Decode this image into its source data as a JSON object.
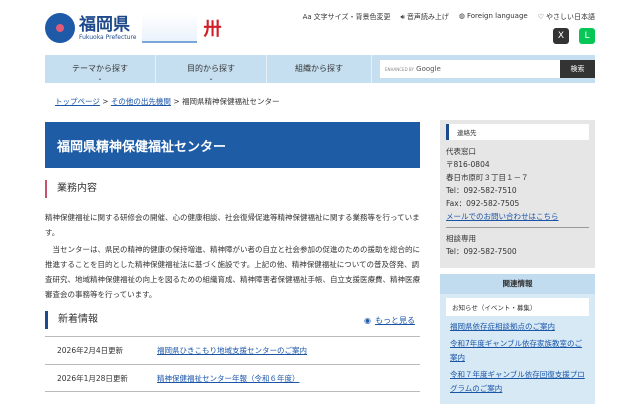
{
  "header": {
    "logo_title": "福岡県",
    "logo_sub": "Fukuoka Prefecture",
    "mascot": "卅",
    "utility": [
      {
        "icon": "text-size-icon",
        "label": "文字サイズ・背景色変更"
      },
      {
        "icon": "speaker-icon",
        "label": "音声読み上げ"
      },
      {
        "icon": "globe-icon",
        "label": "Foreign language"
      },
      {
        "icon": "heart-icon",
        "label": "やさしい日本語"
      }
    ],
    "sns": [
      {
        "name": "x",
        "label": "X",
        "color": "#333333"
      },
      {
        "name": "line",
        "label": "L",
        "color": "#06c755"
      }
    ]
  },
  "nav": {
    "items": [
      "テーマから探す",
      "目的から探す",
      "組織から探す"
    ],
    "search_placeholder_small": "ENHANCED BY",
    "search_placeholder": "Google",
    "search_button": "検索"
  },
  "breadcrumb": {
    "items": [
      "トップページ",
      "その他の出先機関"
    ],
    "current": "福岡県精神保健福祉センター",
    "sep": ">"
  },
  "main": {
    "title": "福岡県精神保健福祉センター",
    "section_title": "業務内容",
    "para1": "精神保健福祉に関する研修会の開催、心の健康相談、社会復帰促進等精神保健福祉に関する業務等を行っています。",
    "para2": "　当センターは、県民の精神的健康の保持増進、精神障がい者の自立と社会参加の促進のための援助を総合的に推進することを目的とした精神保健福祉法に基づく施設です。上記の他、精神保健福祉についての普及啓発、調査研究、地域精神保健福祉の向上を図るための組織育成、精神障害者保健福祉手帳、自立支援医療費、精神医療審査会の事務等を行っています。",
    "news_title": "新着情報",
    "more": "もっと見る",
    "news": [
      {
        "date": "2026年2月4日更新",
        "title": "福岡県ひきこもり地域支援センターのご案内"
      },
      {
        "date": "2026年1月28日更新",
        "title": "精神保健福祉センター年報（令和６年度）"
      }
    ]
  },
  "contact": {
    "heading": "連絡先",
    "lines": [
      "代表窓口",
      "〒816-0804",
      "春日市原町３丁目１－７",
      "Tel：092-582-7510",
      "Fax：092-582-7505"
    ],
    "mail": "メールでのお問い合わせはこちら",
    "lines2": [
      "相談専用",
      "Tel：092-582-7500"
    ]
  },
  "related": {
    "heading": "関連情報",
    "sub": "お知らせ（イベント・募集）",
    "links": [
      "福岡県依存症相談拠点のご案内",
      "令和7年度ギャンブル依存家族教室のご案内",
      "令和７年度ギャンブル依存回復支援プログラムのご案内"
    ]
  }
}
